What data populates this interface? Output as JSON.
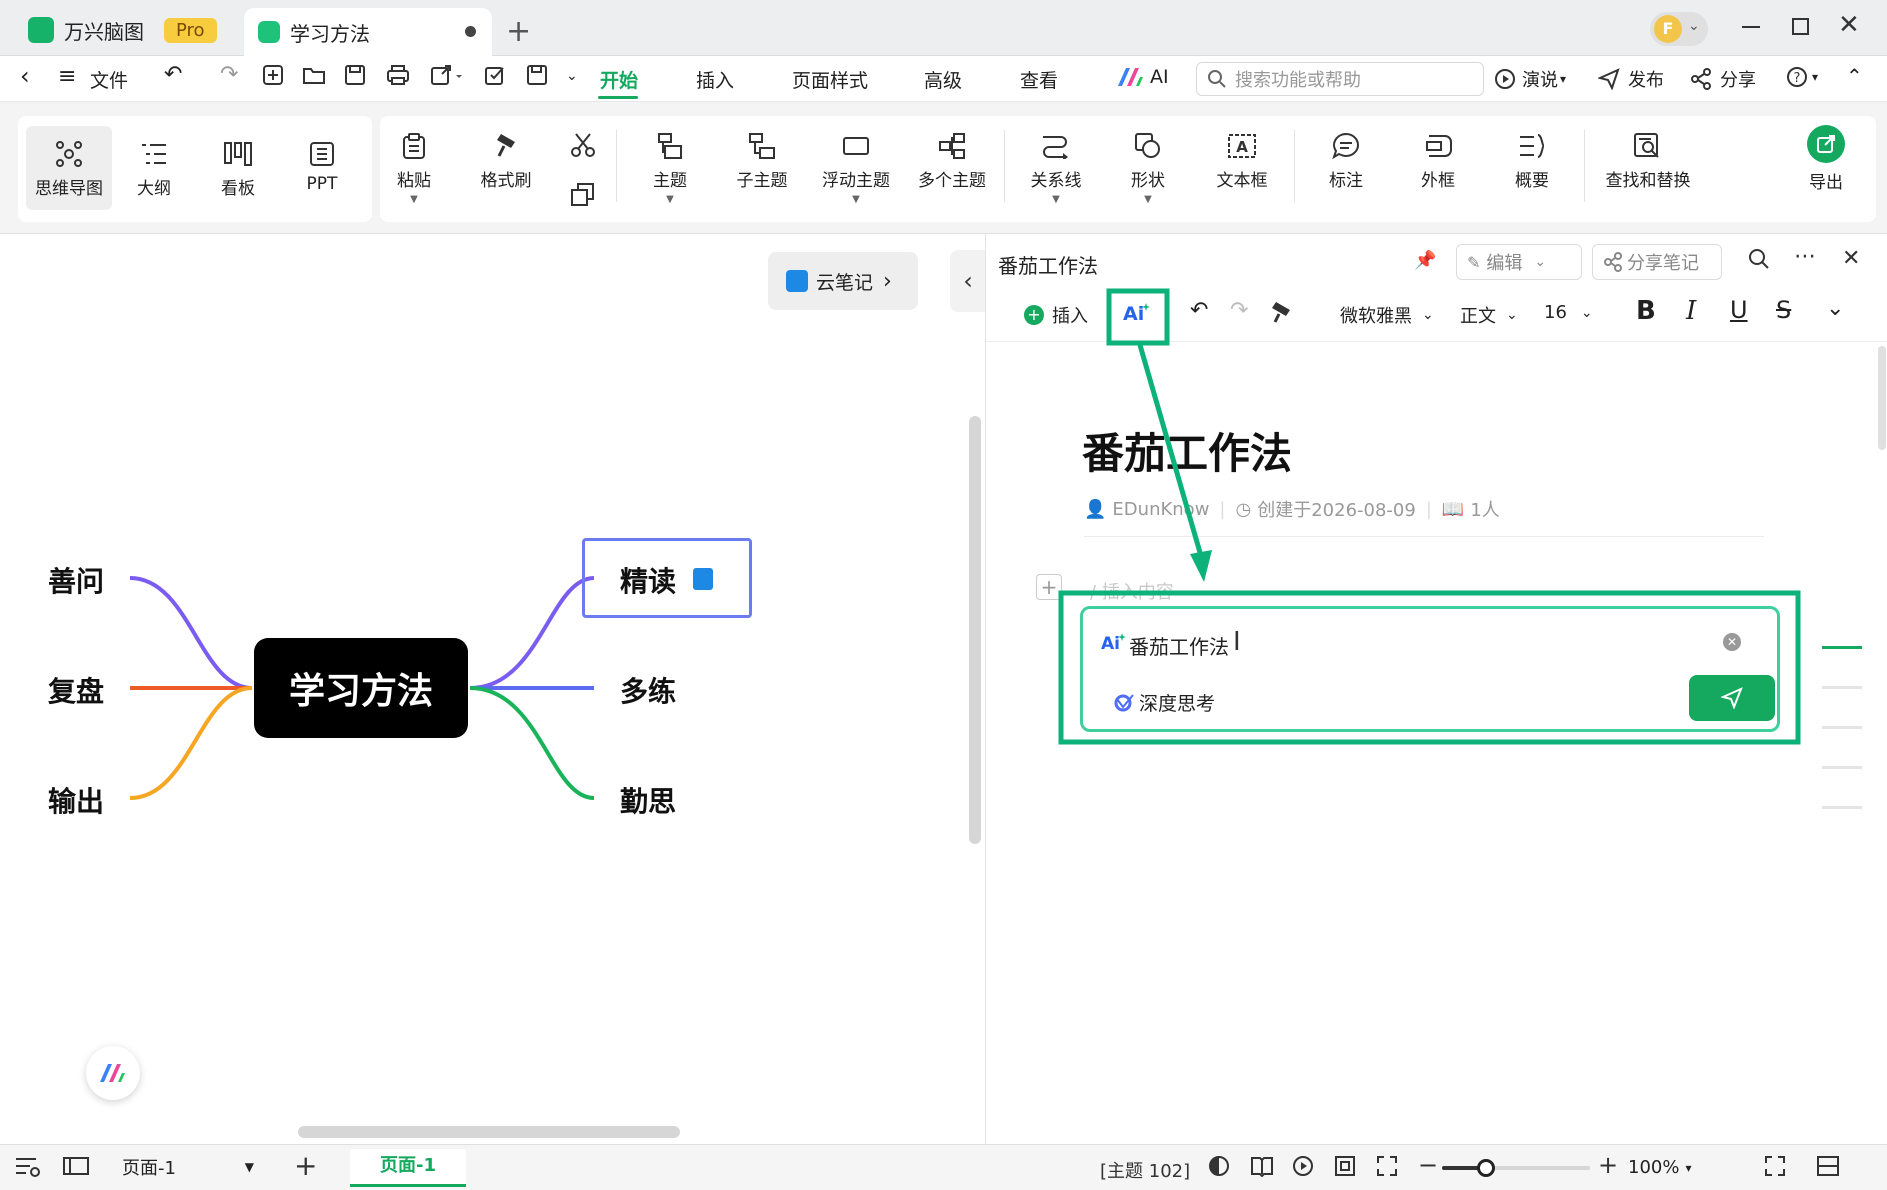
{
  "titlebar": {
    "app_tab": "万兴脑图",
    "pro_badge": "Pro",
    "doc_tab": "学习方法",
    "avatar_letter": "F"
  },
  "menubar": {
    "file": "文件",
    "items": [
      "开始",
      "插入",
      "页面样式",
      "高级",
      "查看",
      "AI"
    ],
    "search_placeholder": "搜索功能或帮助",
    "present": "演说",
    "publish": "发布",
    "share": "分享"
  },
  "ribbon": {
    "views": [
      "思维导图",
      "大纲",
      "看板",
      "PPT"
    ],
    "paste": "粘贴",
    "format_painter": "格式刷",
    "topic": "主题",
    "subtopic": "子主题",
    "floating_topic": "浮动主题",
    "multiple_topics": "多个主题",
    "relationship": "关系线",
    "shape": "形状",
    "textbox": "文本框",
    "callout": "标注",
    "boundary": "外框",
    "summary": "概要",
    "find_replace": "查找和替换",
    "export": "导出"
  },
  "canvas": {
    "cloud_note": "云笔记",
    "central": "学习方法",
    "left_nodes": [
      "善问",
      "复盘",
      "输出"
    ],
    "right_nodes": [
      "精读",
      "多练",
      "勤思"
    ]
  },
  "notes": {
    "header_title": "番茄工作法",
    "edit": "编辑",
    "share_note": "分享笔记",
    "insert": "插入",
    "font_family": "微软雅黑",
    "paragraph": "正文",
    "font_size": "16",
    "doc_title": "番茄工作法",
    "author": "EDunKnow",
    "created": "创建于2026-08-09",
    "readers": "1人",
    "placeholder": "/ 插入内容",
    "ai_input": "番茄工作法",
    "deep_think": "深度思考"
  },
  "status": {
    "page_select": "页面-1",
    "page_tab": "页面-1",
    "topic_count": "[主题 102]",
    "zoom": "100%",
    "zoom_level": 0.3
  },
  "colors": {
    "accent": "#15a85f",
    "annotation": "#0db27b",
    "selected_node": "#6b7cf0"
  }
}
